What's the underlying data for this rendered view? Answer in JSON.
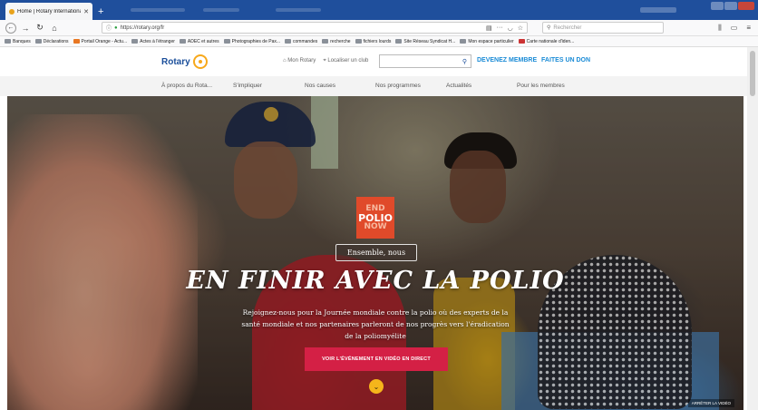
{
  "browser": {
    "tab_title": "Home | Rotary International",
    "tab_close": "✕",
    "new_tab": "+",
    "url": "https://rotary.org/fr",
    "search_placeholder": "Rechercher",
    "bookmarks": [
      "Banques",
      "Déclarations",
      "Portail Orange - Actu...",
      "Actes à l'étranger",
      "ADEC et autres",
      "Photographies de Pax...",
      "commandes",
      "recherche",
      "fichiers lourds",
      "Site Réseau Syndicat H...",
      "Mon espace particulier",
      "Carte nationale d'iden..."
    ]
  },
  "site": {
    "logo_text": "Rotary",
    "header_links": [
      "Mon Rotary",
      "Localiser un club"
    ],
    "become_member": "DEVENEZ MEMBRE",
    "donate": "FAITES UN DON",
    "nav": [
      "À propos du Rota...",
      "S'impliquer",
      "Nos causes",
      "Nos programmes",
      "Actualités",
      "Pour les membres"
    ]
  },
  "hero": {
    "badge": [
      "END",
      "POLIO",
      "NOW"
    ],
    "tagline": "Ensemble, nous",
    "headline": "EN FINIR AVEC LA POLIO",
    "subtext": "Rejoignez-nous pour la Journée mondiale contre la polio où des experts de la santé mondiale et nos partenaires parleront de nos progrès vers l'éradication de la poliomyélite",
    "cta": "VOIR L'ÉVÉNEMENT EN VIDÉO EN DIRECT",
    "stop_video": "ARRÊTER LA VIDÉO"
  },
  "colors": {
    "tabbar": "#1f4f9c",
    "rotary_blue": "#1a4e9a",
    "rotary_gold": "#f7a81b",
    "cta_red": "#d42045",
    "link_blue": "#1a8bd6"
  }
}
